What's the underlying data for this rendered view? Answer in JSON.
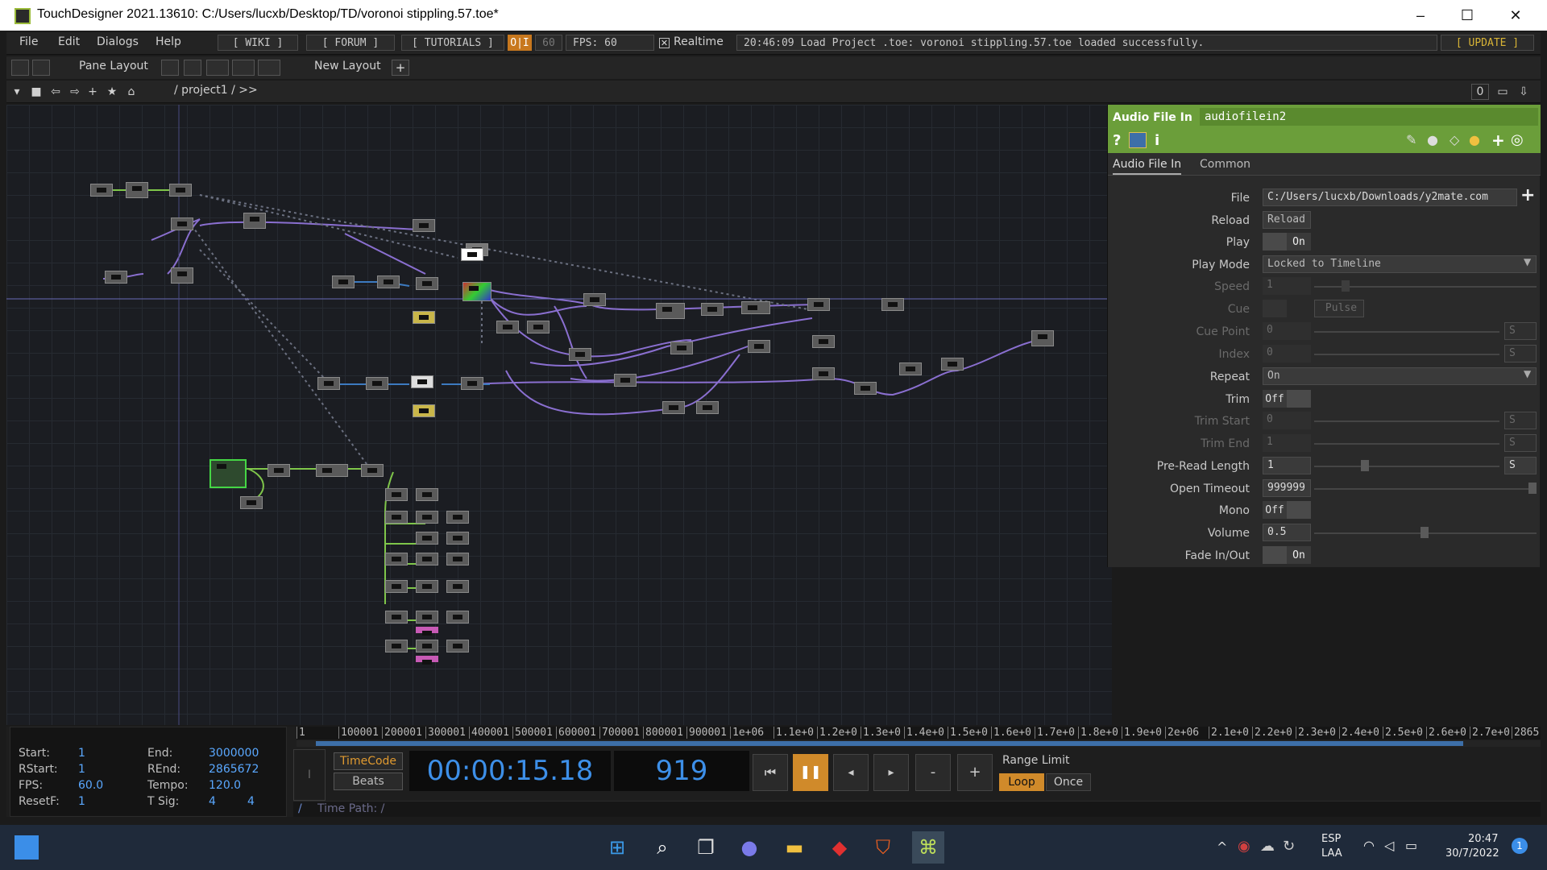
{
  "window": {
    "title": "TouchDesigner 2021.13610: C:/Users/lucxb/Desktop/TD/voronoi stippling.57.toe*",
    "minimize": "–",
    "maximize": "☐",
    "close": "✕"
  },
  "menubar": {
    "items": [
      "File",
      "Edit",
      "Dialogs",
      "Help"
    ],
    "wiki": "[ WIKI ]",
    "forum": "[ FORUM ]",
    "tutorials": "[ TUTORIALS ]",
    "oi": "O|I",
    "fps_target": "60",
    "fps": "FPS:  60",
    "realtime": "Realtime",
    "status": "20:46:09 Load Project .toe: voronoi stippling.57.toe loaded successfully.",
    "update": "[ UPDATE ]"
  },
  "layoutbar": {
    "pane_layout": "Pane Layout",
    "new_layout": "New Layout",
    "add": "+"
  },
  "pathbar": {
    "path": "/ project1 / >>",
    "counter": "0"
  },
  "params": {
    "op_type": "Audio File In",
    "op_name": "audiofilein2",
    "tabs": [
      "Audio File In",
      "Common"
    ],
    "file_label": "File",
    "file_value": "C:/Users/lucxb/Downloads/y2mate.com",
    "reload_label": "Reload",
    "reload_button": "Reload",
    "play_label": "Play",
    "play_value": "On",
    "playmode_label": "Play Mode",
    "playmode_value": "Locked to Timeline",
    "speed_label": "Speed",
    "speed_value": "1",
    "cue_label": "Cue",
    "cue_pulse": "Pulse",
    "cuepoint_label": "Cue Point",
    "cuepoint_value": "0",
    "cuepoint_unit": "S",
    "index_label": "Index",
    "index_value": "0",
    "index_unit": "S",
    "repeat_label": "Repeat",
    "repeat_value": "On",
    "trim_label": "Trim",
    "trim_value": "Off",
    "trimstart_label": "Trim Start",
    "trimstart_value": "0",
    "trimstart_unit": "S",
    "trimend_label": "Trim End",
    "trimend_value": "1",
    "trimend_unit": "S",
    "preread_label": "Pre-Read Length",
    "preread_value": "1",
    "preread_unit": "S",
    "opentimeout_label": "Open Timeout",
    "opentimeout_value": "999999",
    "mono_label": "Mono",
    "mono_value": "Off",
    "volume_label": "Volume",
    "volume_value": "0.5",
    "fade_label": "Fade In/Out",
    "fade_value": "On"
  },
  "timeline": {
    "start_k": "Start:",
    "start_v": "1",
    "end_k": "End:",
    "end_v": "3000000",
    "rstart_k": "RStart:",
    "rstart_v": "1",
    "rend_k": "REnd:",
    "rend_v": "2865672",
    "fps_k": "FPS:",
    "fps_v": "60.0",
    "tempo_k": "Tempo:",
    "tempo_v": "120.0",
    "resetf_k": "ResetF:",
    "resetf_v": "1",
    "tsig_k": "T Sig:",
    "tsig_v1": "4",
    "tsig_v2": "4",
    "ruler_ticks": [
      "1",
      "100001",
      "200001",
      "300001",
      "400001",
      "500001",
      "600001",
      "700001",
      "800001",
      "900001",
      "1e+06",
      "1.1e+0",
      "1.2e+0",
      "1.3e+0",
      "1.4e+0",
      "1.5e+0",
      "1.6e+0",
      "1.7e+0",
      "1.8e+0",
      "1.9e+0",
      "2e+06",
      "2.1e+0",
      "2.2e+0",
      "2.3e+0",
      "2.4e+0",
      "2.5e+0",
      "2.6e+0",
      "2.7e+0",
      "2865"
    ],
    "timecode_btn": "TimeCode",
    "beats_btn": "Beats",
    "timecode": "00:00:15.18",
    "frame": "919",
    "range_limit": "Range Limit",
    "loop": "Loop",
    "once": "Once",
    "time_path": "Time Path: /",
    "minus": "-",
    "plus": "+"
  },
  "taskbar": {
    "lang1": "ESP",
    "lang2": "LAA",
    "time": "20:47",
    "date": "30/7/2022",
    "badge": "1"
  },
  "colors": {
    "accent_green": "#6b9e3a",
    "timeline_orange": "#d08a2a",
    "value_blue": "#5aa8ff",
    "wire_purple": "#8a6fd0",
    "wire_green": "#7fc64a"
  }
}
